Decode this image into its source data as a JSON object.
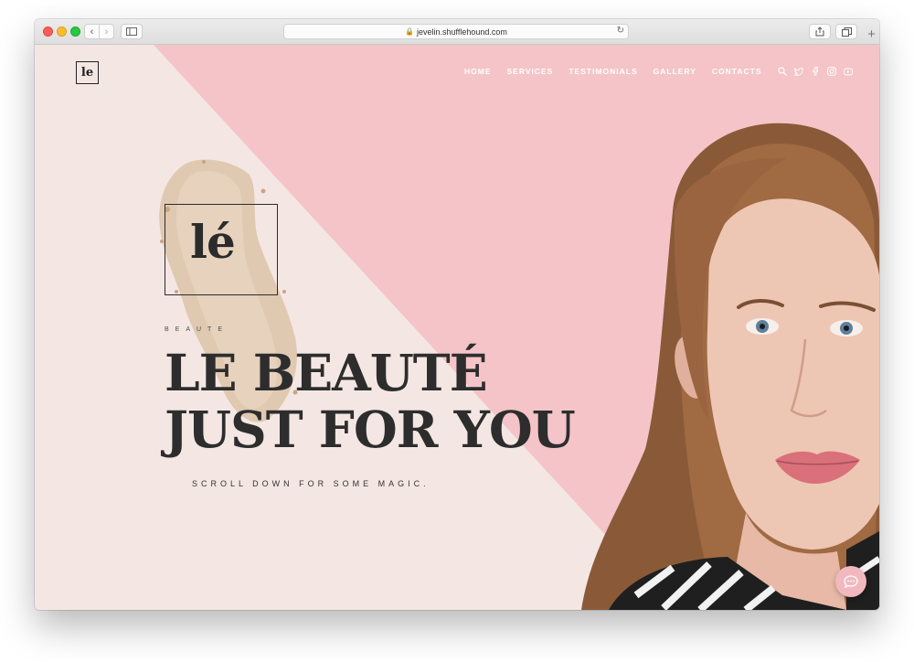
{
  "browser": {
    "url": "jevelin.shufflehound.com",
    "icons": [
      "back-icon",
      "forward-icon",
      "sidebar-icon",
      "lock-icon",
      "reload-icon",
      "share-icon",
      "tabs-icon",
      "new-tab-icon"
    ]
  },
  "site": {
    "logo_text": "le",
    "nav": [
      {
        "label": "HOME"
      },
      {
        "label": "SERVICES"
      },
      {
        "label": "TESTIMONIALS"
      },
      {
        "label": "GALLERY"
      },
      {
        "label": "CONTACTS"
      }
    ],
    "nav_icons": [
      "search-icon",
      "twitter-icon",
      "facebook-icon",
      "instagram-icon",
      "youtube-icon"
    ]
  },
  "hero": {
    "brand_mark": "lé",
    "brand_sub": "BEAUTE",
    "title_line1": "LE BEAUTÉ",
    "title_line2": "JUST FOR YOU",
    "subtitle": "SCROLL DOWN FOR SOME MAGIC."
  },
  "colors": {
    "pink": "#f4c4c8",
    "cream": "#f4e7e3",
    "text_dark": "#2d2d2d",
    "chat_bubble": "#f2b8c0"
  }
}
